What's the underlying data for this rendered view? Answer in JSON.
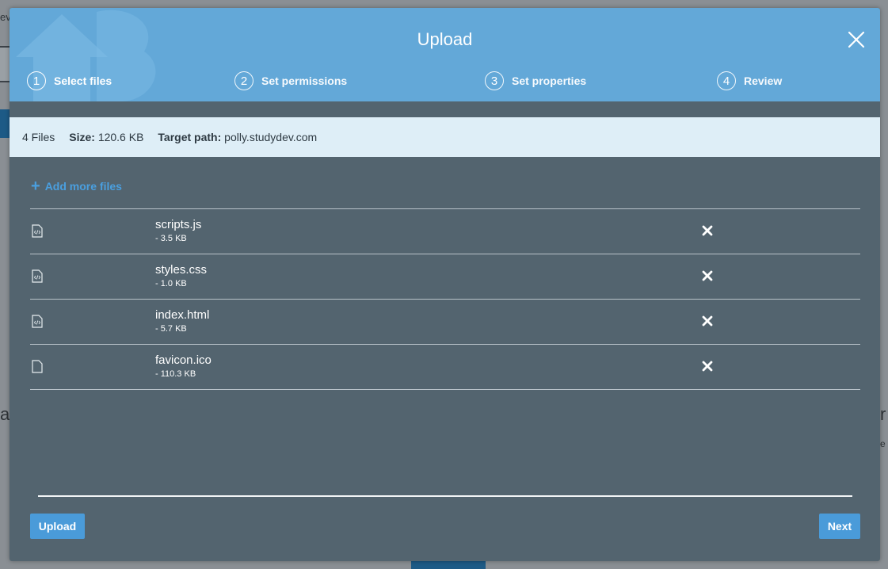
{
  "dialog": {
    "title": "Upload",
    "steps": [
      {
        "number": "1",
        "label": "Select files",
        "active": true
      },
      {
        "number": "2",
        "label": "Set permissions",
        "active": false
      },
      {
        "number": "3",
        "label": "Set properties",
        "active": false
      },
      {
        "number": "4",
        "label": "Review",
        "active": false
      }
    ]
  },
  "summary": {
    "files_count": "4 Files",
    "size_label": "Size:",
    "size_value": "120.6 KB",
    "target_label": "Target path:",
    "target_value": "polly.studydev.com"
  },
  "add_more": {
    "icon": "plus-icon",
    "label": "Add more files"
  },
  "files": [
    {
      "name": "scripts.js",
      "size": "- 3.5 KB",
      "icon": "code-file-icon"
    },
    {
      "name": "styles.css",
      "size": "- 1.0 KB",
      "icon": "code-file-icon"
    },
    {
      "name": "index.html",
      "size": "- 5.7 KB",
      "icon": "code-file-icon"
    },
    {
      "name": "favicon.ico",
      "size": "- 110.3 KB",
      "icon": "blank-file-icon"
    }
  ],
  "footer": {
    "upload_label": "Upload",
    "next_label": "Next"
  },
  "colors": {
    "header": "#63a8d8",
    "body": "#53646f",
    "info_bar": "#deeef7",
    "accent": "#4a9bd9"
  }
}
